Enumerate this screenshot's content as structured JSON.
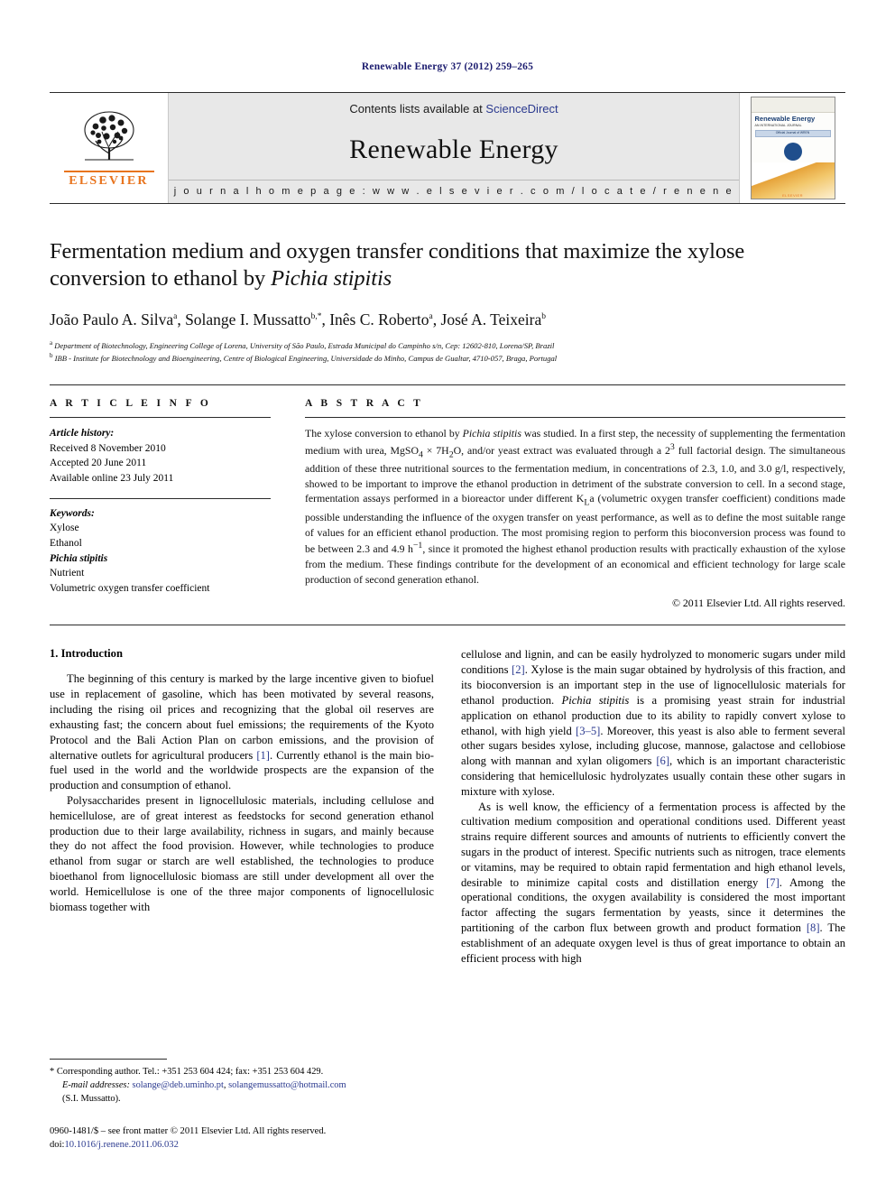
{
  "running_head": "Renewable Energy 37 (2012) 259–265",
  "masthead": {
    "contents_prefix": "Contents lists available at",
    "sciencedirect": "ScienceDirect",
    "journal_name": "Renewable Energy",
    "homepage": "j o u r n a l   h o m e p a g e :   w w w . e l s e v i e r . c o m / l o c a t e / r e n e n e",
    "publisher_wordmark": "ELSEVIER",
    "cover": {
      "title": "Renewable Energy",
      "subtitle": "AN INTERNATIONAL JOURNAL",
      "band": "Official Journal of WREN",
      "footer": "ELSEVIER"
    }
  },
  "article": {
    "title_part1": "Fermentation medium and oxygen transfer conditions that maximize the xylose conversion to ethanol by ",
    "title_italic": "Pichia stipitis",
    "authors": "João Paulo A. Silva a, Solange I. Mussatto b,*, Inês C. Roberto a, José A. Teixeira b",
    "affiliation_a": "Department of Biotechnology, Engineering College of Lorena, University of São Paulo, Estrada Municipal do Campinho s/n, Cep: 12602-810, Lorena/SP, Brazil",
    "affiliation_b": "IBB - Institute for Biotechnology and Bioengineering, Centre of Biological Engineering, Universidade do Minho, Campus de Gualtar, 4710-057, Braga, Portugal"
  },
  "article_info": {
    "heading": "A R T I C L E   I N F O",
    "history_label": "Article history:",
    "history": [
      "Received 8 November 2010",
      "Accepted 20 June 2011",
      "Available online 23 July 2011"
    ],
    "keywords_label": "Keywords:",
    "keywords": [
      "Xylose",
      "Ethanol",
      "Pichia stipitis",
      "Nutrient",
      "Volumetric oxygen transfer coefficient"
    ]
  },
  "abstract": {
    "heading": "A B S T R A C T",
    "text_1": "The xylose conversion to ethanol by ",
    "text_italic_1": "Pichia stipitis",
    "text_2": " was studied. In a first step, the necessity of supplementing the fermentation medium with urea, MgSO",
    "sub_1": "4",
    "text_3": " × 7H",
    "sub_2": "2",
    "text_4": "O, and/or yeast extract was evaluated through a 2",
    "sup_1": "3",
    "text_5": " full factorial design. The simultaneous addition of these three nutritional sources to the fermentation medium, in concentrations of 2.3, 1.0, and 3.0 g/l, respectively, showed to be important to improve the ethanol production in detriment of the substrate conversion to cell. In a second stage, fermentation assays performed in a bioreactor under different K",
    "sub_3": "L",
    "text_6": "a (volumetric oxygen transfer coefficient) conditions made possible understanding the influence of the oxygen transfer on yeast performance, as well as to define the most suitable range of values for an efficient ethanol production. The most promising region to perform this bioconversion process was found to be between 2.3 and 4.9 h",
    "sup_2": "−1",
    "text_7": ", since it promoted the highest ethanol production results with practically exhaustion of the xylose from the medium. These findings contribute for the development of an economical and efficient technology for large scale production of second generation ethanol.",
    "copyright": "© 2011 Elsevier Ltd. All rights reserved."
  },
  "introduction": {
    "section_number_title": "1. Introduction",
    "left_para_1_a": "The beginning of this century is marked by the large incentive given to biofuel use in replacement of gasoline, which has been motivated by several reasons, including the rising oil prices and recognizing that the global oil reserves are exhausting fast; the concern about fuel emissions; the requirements of the Kyoto Protocol and the Bali Action Plan on carbon emissions, and the provision of alternative outlets for agricultural producers ",
    "left_para_1_ref": "[1]",
    "left_para_1_b": ". Currently ethanol is the main bio-fuel used in the world and the worldwide prospects are the expansion of the production and consumption of ethanol.",
    "left_para_2": "Polysaccharides present in lignocellulosic materials, including cellulose and hemicellulose, are of great interest as feedstocks for second generation ethanol production due to their large availability, richness in sugars, and mainly because they do not affect the food provision. However, while technologies to produce ethanol from sugar or starch are well established, the technologies to produce bioethanol from lignocellulosic biomass are still under development all over the world. Hemicellulose is one of the three major components of lignocellulosic biomass together with",
    "right_para_1_a": "cellulose and lignin, and can be easily hydrolyzed to monomeric sugars under mild conditions ",
    "right_para_1_ref1": "[2]",
    "right_para_1_b": ". Xylose is the main sugar obtained by hydrolysis of this fraction, and its bioconversion is an important step in the use of lignocellulosic materials for ethanol production. ",
    "right_para_1_italic": "Pichia stipitis",
    "right_para_1_c": " is a promising yeast strain for industrial application on ethanol production due to its ability to rapidly convert xylose to ethanol, with high yield ",
    "right_para_1_ref2": "[3–5]",
    "right_para_1_d": ". Moreover, this yeast is also able to ferment several other sugars besides xylose, including glucose, mannose, galactose and cellobiose along with mannan and xylan oligomers ",
    "right_para_1_ref3": "[6]",
    "right_para_1_e": ", which is an important characteristic considering that hemicellulosic hydrolyzates usually contain these other sugars in mixture with xylose.",
    "right_para_2_a": "As is well know, the efficiency of a fermentation process is affected by the cultivation medium composition and operational conditions used. Different yeast strains require different sources and amounts of nutrients to efficiently convert the sugars in the product of interest. Specific nutrients such as nitrogen, trace elements or vitamins, may be required to obtain rapid fermentation and high ethanol levels, desirable to minimize capital costs and distillation energy ",
    "right_para_2_ref1": "[7]",
    "right_para_2_b": ". Among the operational conditions, the oxygen availability is considered the most important factor affecting the sugars fermentation by yeasts, since it determines the partitioning of the carbon flux between growth and product formation ",
    "right_para_2_ref2": "[8]",
    "right_para_2_c": ". The establishment of an adequate oxygen level is thus of great importance to obtain an efficient process with high"
  },
  "footnotes": {
    "corresponding_marker": "*",
    "corresponding": "Corresponding author. Tel.: +351 253 604 424; fax: +351 253 604 429.",
    "email_label": "E-mail addresses:",
    "email_1": "solange@deb.uminho.pt",
    "email_sep": ", ",
    "email_2": "solangemussatto@hotmail.com",
    "email_owner": "(S.I. Mussatto)."
  },
  "imprint": {
    "line_1": "0960-1481/$ – see front matter © 2011 Elsevier Ltd. All rights reserved.",
    "doi_label": "doi:",
    "doi_value": "10.1016/j.renene.2011.06.032"
  },
  "colors": {
    "link": "#2b3a8f",
    "running_head": "#1a1a6e",
    "elsevier_orange": "#e8741e"
  }
}
